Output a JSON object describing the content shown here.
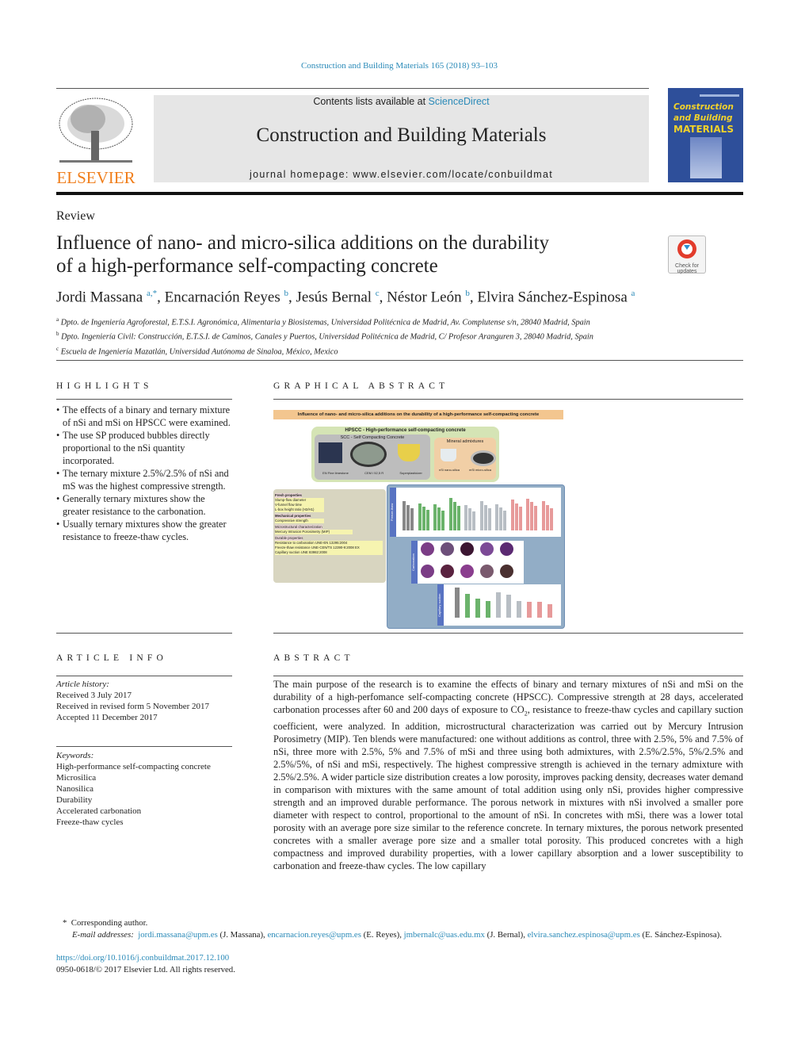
{
  "header": {
    "journal_ref": "Construction and Building Materials 165 (2018) 93–103",
    "contents_prefix": "Contents lists available at ",
    "contents_link": "ScienceDirect",
    "journal_title": "Construction and Building Materials",
    "homepage": "journal homepage: www.elsevier.com/locate/conbuildmat",
    "publisher_logo": "ELSEVIER",
    "cover": {
      "line1": "Construction",
      "line2": "and Building",
      "line3": "MATERIALS"
    },
    "check_updates": "Check for updates"
  },
  "article": {
    "type": "Review",
    "title_line1": "Influence of nano- and micro-silica additions on the durability",
    "title_line2": "of a high-performance self-compacting concrete",
    "authors": [
      {
        "name": "Jordi Massana",
        "sup": "a,*",
        "sep": ", "
      },
      {
        "name": "Encarnación Reyes",
        "sup": "b",
        "sep": ", "
      },
      {
        "name": "Jesús Bernal",
        "sup": "c",
        "sep": ", "
      },
      {
        "name": "Néstor León",
        "sup": "b",
        "sep": ", "
      },
      {
        "name": "Elvira Sánchez-Espinosa",
        "sup": "a",
        "sep": ""
      }
    ],
    "affiliations": [
      {
        "sup": "a",
        "text": "Dpto. de Ingeniería Agroforestal, E.T.S.I. Agronómica, Alimentaria y Biosistemas, Universidad Politécnica de Madrid, Av. Complutense s/n, 28040 Madrid, Spain"
      },
      {
        "sup": "b",
        "text": "Dpto. Ingeniería Civil: Construcción, E.T.S.I. de Caminos, Canales y Puertos, Universidad Politécnica de Madrid, C/ Profesor Aranguren 3, 28040 Madrid, Spain"
      },
      {
        "sup": "c",
        "text": "Escuela de Ingeniería Mazatlán, Universidad Autónoma de Sinaloa, México, Mexico"
      }
    ]
  },
  "highlights": {
    "heading": "HIGHLIGHTS",
    "items": [
      "The effects of a binary and ternary mixture of nSi and mSi on HPSCC were examined.",
      "The use SP produced bubbles directly proportional to the nSi quantity incorporated.",
      "The ternary mixture 2.5%/2.5% of nSi and mS was the highest compressive strength.",
      "Generally ternary mixtures show the greater resistance to the carbonation.",
      "Usually ternary mixtures show the greater resistance to freeze-thaw cycles."
    ]
  },
  "graphical_abstract": {
    "heading": "GRAPHICAL ABSTRACT",
    "banner": "Influence of nano- and micro-silica additions on the durability of a high-performance self-compacting concrete",
    "hpscc": "HPSCC - High-performance self-compacting concrete",
    "scc": "SCC - Self Compacting Concrete",
    "scc_items": [
      "EN Fine limestone",
      "CEM I 52,5 R",
      "Superplasticizer"
    ],
    "mineral": "Mineral admixtures",
    "mineral_items": [
      "nSi nano-silica",
      "mSi micro-silica"
    ],
    "properties": [
      {
        "title": "Fresh properties",
        "items": [
          "Slump-flow diameter",
          "V-funnel flow time",
          "L-box height ratio (H2/H1)"
        ]
      },
      {
        "title": "Mechanical properties",
        "items": [
          "Compressive strength"
        ]
      },
      {
        "title": "Microstructural characterization",
        "items": [
          "Mercury Intrusion Porosimetry (MIP)"
        ]
      },
      {
        "title": "Durable properties",
        "items": [
          "Resistance to carbonation UNE-EN 13295:2004",
          "Freeze-thaw resistance UNE-CEN/TS 12390-9:2008 EX",
          "Capillary suction UNE 83982:2008"
        ]
      }
    ],
    "panel_labels": [
      "Freeze-thaw",
      "Carbonation",
      "Capillary suction"
    ],
    "colors": {
      "banner": "#f3c68f",
      "hpscc": "#d5e4b5",
      "scc": "#bdbdbd",
      "mineral": "#f1cfa6",
      "props": "#d8d5c0",
      "results": "#92adc6"
    }
  },
  "article_info": {
    "heading": "ARTICLE INFO",
    "history_label": "Article history:",
    "history": [
      "Received 3 July 2017",
      "Received in revised form 5 November 2017",
      "Accepted 11 December 2017"
    ],
    "keywords_label": "Keywords:",
    "keywords": [
      "High-performance self-compacting concrete",
      "Microsilica",
      "Nanosilica",
      "Durability",
      "Accelerated carbonation",
      "Freeze-thaw cycles"
    ]
  },
  "abstract": {
    "heading": "ABSTRACT",
    "part1": "The main purpose of the research is to examine the effects of binary and ternary mixtures of nSi and mSi on the durability of a high-perfomance self-compacting concrete (HPSCC). Compressive strength at 28 days, accelerated carbonation processes after 60 and 200 days of exposure to ",
    "co": "CO",
    "sub": "2",
    "part2": ", resistance to freeze-thaw cycles and capillary suction coefficient, were analyzed. In addition, microstructural characterization was carried out by Mercury Intrusion Porosimetry (MIP). Ten blends were manufactured: one without additions as control, three with 2.5%, 5% and 7.5% of nSi, three more with 2.5%, 5% and 7.5% of mSi and three using both admixtures, with 2.5%/2.5%, 5%/2.5% and 2.5%/5%, of nSi and mSi, respectively. The highest compressive strength is achieved in the ternary admixture with 2.5%/2.5%. A wider particle size distribution creates a low porosity, improves packing density, decreases water demand in comparison with mixtures with the same amount of total addition using only nSi, provides higher compressive strength and an improved durable performance. The porous network in mixtures with nSi involved a smaller pore diameter with respect to control, proportional to the amount of nSi. In concretes with mSi, there was a lower total porosity with an average pore size similar to the reference concrete. In ternary mixtures, the porous network presented concretes with a smaller average pore size and a smaller total porosity. This produced concretes with a high compactness and improved durability properties, with a lower capillary absorption and a lower susceptibility to carbonation and freeze-thaw cycles. The low capillary"
  },
  "footnotes": {
    "corresponding": "Corresponding author.",
    "email_label": "E-mail addresses:",
    "emails": [
      {
        "addr": "jordi.massana@upm.es",
        "who": "(J. Massana),"
      },
      {
        "addr": "encarnacion.reyes@upm.es",
        "who": "(E. Reyes),"
      },
      {
        "addr": "jmbernalc@uas.edu.mx",
        "who": "(J. Bernal),"
      },
      {
        "addr": "elvira.sanchez.espinosa@upm.es",
        "who": "(E. Sánchez-Espinosa)."
      }
    ],
    "doi": "https://doi.org/10.1016/j.conbuildmat.2017.12.100",
    "copyright": "0950-0618/© 2017 Elsevier Ltd. All rights reserved."
  }
}
